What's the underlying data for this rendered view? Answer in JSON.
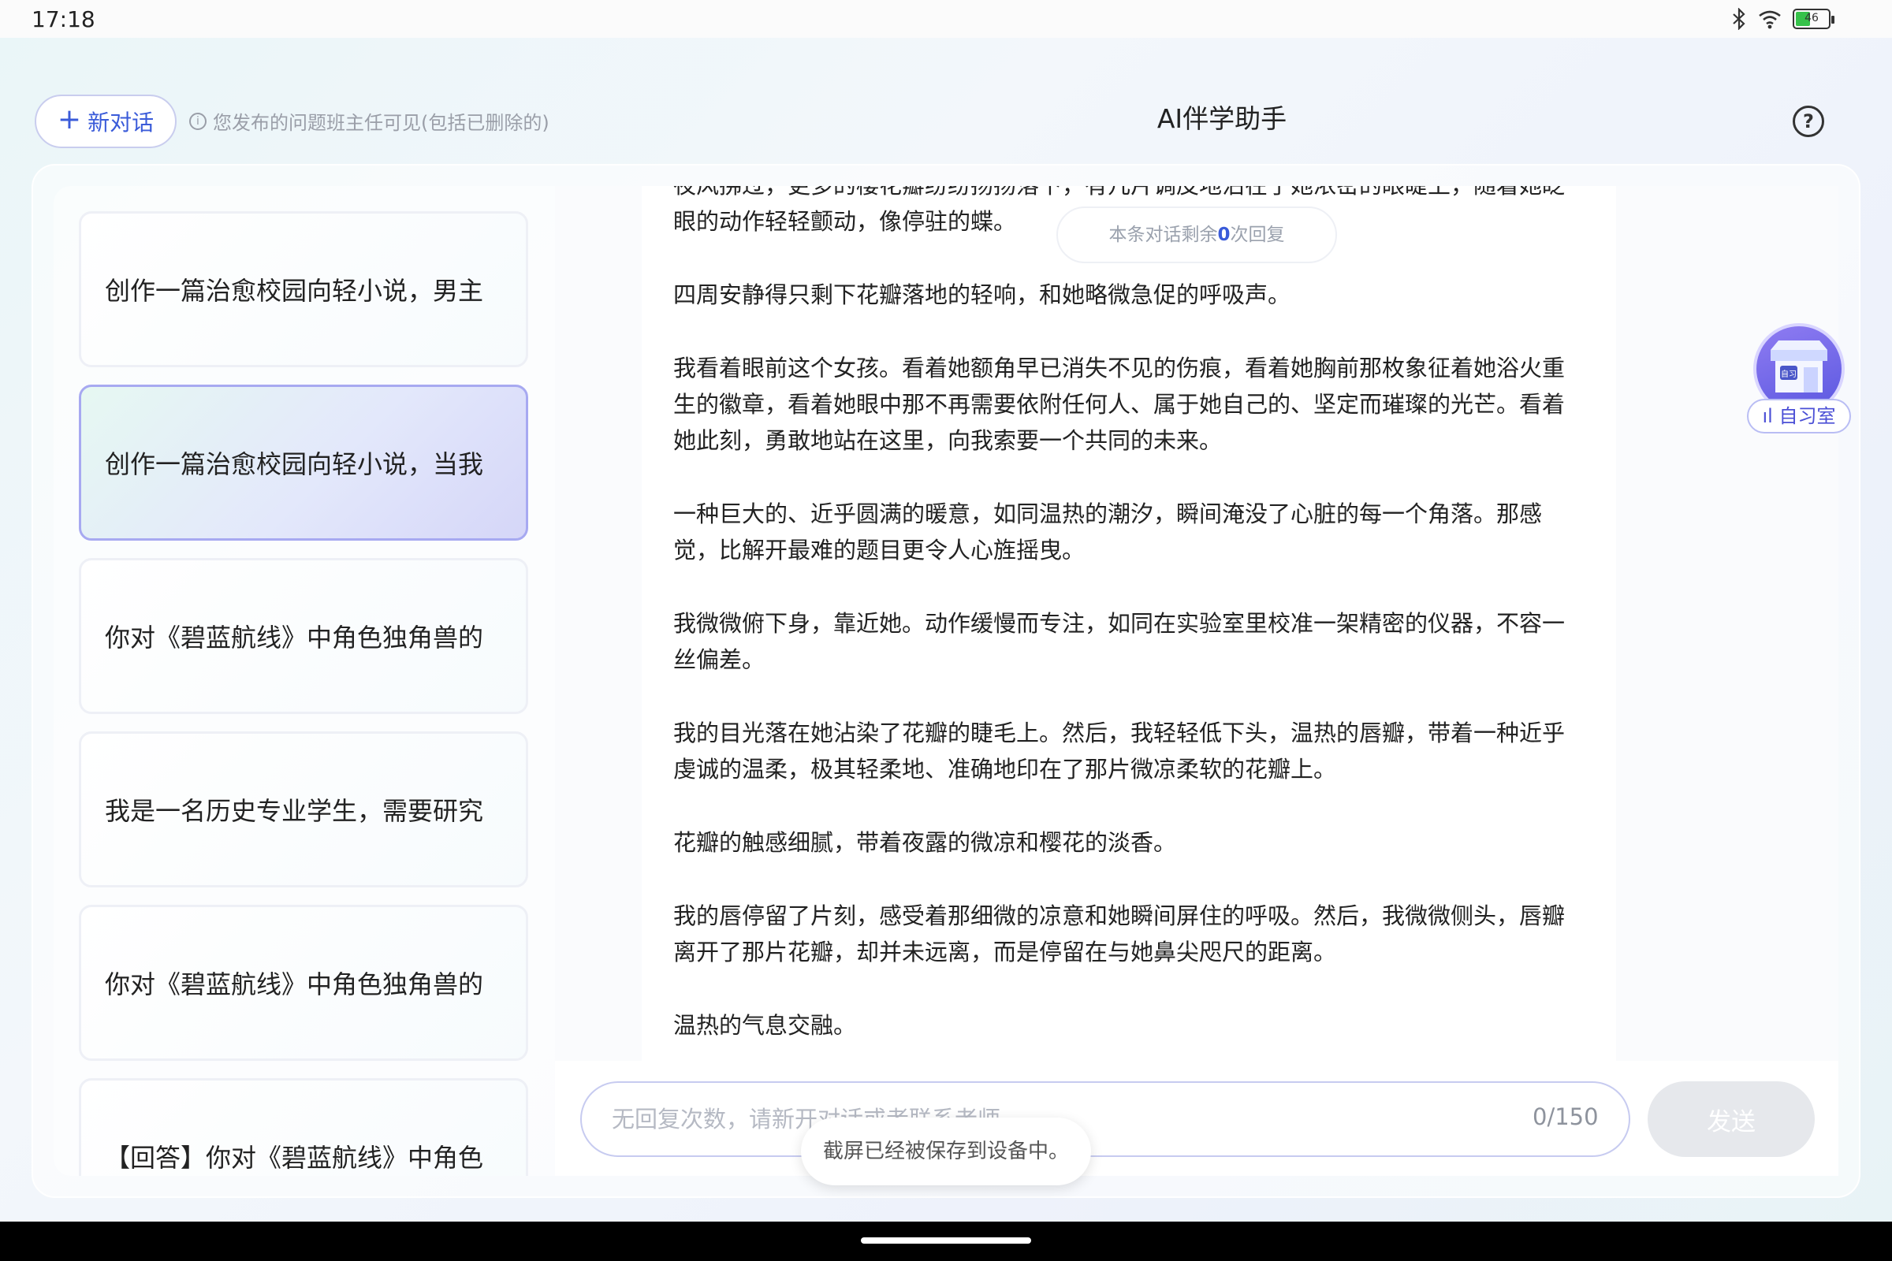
{
  "status_bar": {
    "time": "17:18",
    "battery": "46"
  },
  "header": {
    "new_chat_label": "新对话",
    "notice": "您发布的问题班主任可见(包括已删除的)",
    "title": "AI伴学助手"
  },
  "sidebar": {
    "items": [
      {
        "label": "创作一篇治愈校园向轻小说，男主"
      },
      {
        "label": "创作一篇治愈校园向轻小说，当我"
      },
      {
        "label": "你对《碧蓝航线》中角色独角兽的"
      },
      {
        "label": "我是一名历史专业学生，需要研究"
      },
      {
        "label": "你对《碧蓝航线》中角色独角兽的"
      },
      {
        "label": "【回答】你对《碧蓝航线》中角色"
      }
    ],
    "active_index": 1
  },
  "message": {
    "paragraphs": [
      "夜风拂过，更多的樱花瓣纷纷扬扬落下，有几片调皮地沾在了她浓密的眼睫上，随着她眨眼的动作轻轻颤动，像停驻的蝶。",
      "四周安静得只剩下花瓣落地的轻响，和她略微急促的呼吸声。",
      "我看着眼前这个女孩。看着她额角早已消失不见的伤痕，看着她胸前那枚象征着她浴火重生的徽章，看着她眼中那不再需要依附任何人、属于她自己的、坚定而璀璨的光芒。看着她此刻，勇敢地站在这里，向我索要一个共同的未来。",
      "一种巨大的、近乎圆满的暖意，如同温热的潮汐，瞬间淹没了心脏的每一个角落。那感觉，比解开最难的题目更令人心旌摇曳。",
      "我微微俯下身，靠近她。动作缓慢而专注，如同在实验室里校准一架精密的仪器，不容一丝偏差。",
      "我的目光落在她沾染了花瓣的睫毛上。然后，我轻轻低下头，温热的唇瓣，带着一种近乎虔诚的温柔，极其轻柔地、准确地印在了那片微凉柔软的花瓣上。",
      "花瓣的触感细腻，带着夜露的微凉和樱花的淡香。",
      "我的唇停留了片刻，感受着那细微的凉意和她瞬间屏住的呼吸。然后，我微微侧头，唇瓣离开了那片花瓣，却并未远离，而是停留在与她鼻尖咫尺的距离。",
      "温热的气息交融。"
    ]
  },
  "remaining": {
    "prefix": "本条对话剩余",
    "count": "0",
    "suffix": "次回复"
  },
  "study_room": {
    "label": "自习室",
    "sign": "自习"
  },
  "input": {
    "placeholder": "无回复次数，请新开对话或者联系老师",
    "counter": "0/150",
    "send_label": "发送"
  },
  "toast": {
    "text": "截屏已经被保存到设备中。"
  },
  "colors": {
    "accent": "#3a5bd9",
    "active_border": "#a7a9f1",
    "send_disabled": "#e6e8ec"
  }
}
